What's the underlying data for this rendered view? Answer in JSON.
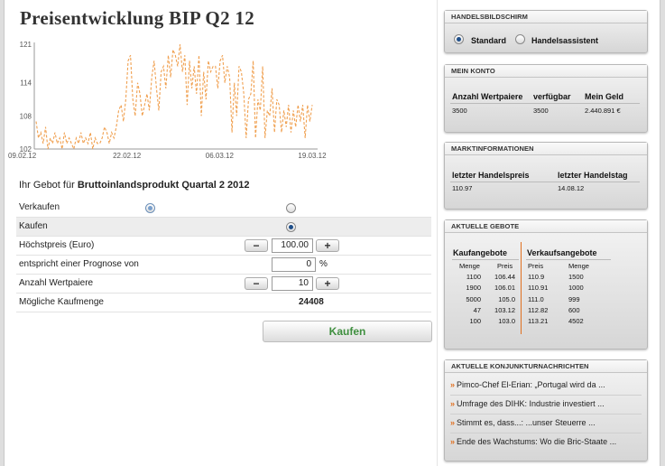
{
  "title": "Preisentwicklung BIP Q2 12",
  "chart_data": {
    "type": "line",
    "y_ticks": [
      "121",
      "114",
      "108",
      "102"
    ],
    "x_ticks": [
      "09.02.12",
      "22.02.12",
      "06.03.12",
      "19.03.12"
    ],
    "ylim": [
      102,
      121
    ],
    "line_color": "#f0a050",
    "line_style": "dashed",
    "series": [
      {
        "values": [
          107,
          104,
          105,
          103,
          106,
          102,
          104,
          103,
          105,
          103,
          104,
          102,
          105,
          103,
          104,
          103,
          102,
          104,
          103,
          105,
          103,
          104,
          103,
          105,
          102,
          104,
          103,
          103,
          104,
          106,
          105,
          103,
          105,
          104,
          106,
          109,
          110,
          107,
          111,
          118,
          119,
          111,
          108,
          114,
          112,
          108,
          110,
          112,
          109,
          115,
          118,
          113,
          109,
          116,
          117,
          113,
          119,
          115,
          120,
          119,
          117,
          121,
          116,
          119,
          110,
          118,
          113,
          117,
          112,
          119,
          108,
          116,
          111,
          118,
          116,
          117,
          117,
          113,
          118,
          119,
          114,
          117,
          115,
          105,
          114,
          108,
          117,
          116,
          112,
          104,
          111,
          112,
          118,
          104,
          111,
          109,
          117,
          104,
          109,
          108,
          113,
          105,
          111,
          110,
          105,
          109,
          106,
          110,
          105,
          109,
          106,
          110,
          107,
          110,
          104,
          110,
          107,
          110
        ]
      }
    ]
  },
  "offer": {
    "prefix": "Ihr Gebot für",
    "instrument": "Bruttoinlandsprodukt Quartal 2 2012"
  },
  "form": {
    "sell_label": "Verkaufen",
    "buy_label": "Kaufen",
    "max_price_label": "Höchstpreis (Euro)",
    "max_price_value": "100.00",
    "forecast_label": "entspricht einer Prognose von",
    "forecast_value": "0",
    "forecast_unit": "%",
    "quantity_label": "Anzahl Wertpaiere",
    "quantity_value": "10",
    "possible_label": "Mögliche Kaufmenge",
    "possible_value": "24408",
    "minus_symbol": "−",
    "plus_symbol": "+",
    "submit_label": "Kaufen"
  },
  "screen_box": {
    "head": "HANDELSBILDSCHIRM",
    "standard_label": "Standard",
    "assistant_label": "Handelsassistent"
  },
  "account_box": {
    "head": "MEIN KONTO",
    "col1": "Anzahl Wertpaiere",
    "col2": "verfügbar",
    "col3": "Mein Geld",
    "v1": "3500",
    "v2": "3500",
    "v3": "2.440.891 €"
  },
  "market_box": {
    "head": "MARKTINFORMATIONEN",
    "col1": "letzter Handelspreis",
    "col2": "letzter Handelstag",
    "v1": "110.97",
    "v2": "14.08.12"
  },
  "offers_box": {
    "head": "AKTUELLE GEBOTE",
    "buy_title": "Kaufangebote",
    "sell_title": "Verkaufsangebote",
    "buy_cols": [
      "Menge",
      "Preis"
    ],
    "sell_cols": [
      "Preis",
      "Menge"
    ],
    "buy_rows": [
      [
        "1100",
        "106.44"
      ],
      [
        "1900",
        "106.01"
      ],
      [
        "5000",
        "105.0"
      ],
      [
        "47",
        "103.12"
      ],
      [
        "100",
        "103.0"
      ]
    ],
    "sell_rows": [
      [
        "110.9",
        "1500"
      ],
      [
        "110.91",
        "1000"
      ],
      [
        "111.0",
        "999"
      ],
      [
        "112.82",
        "600"
      ],
      [
        "113.21",
        "4502"
      ]
    ]
  },
  "news_box": {
    "head": "AKTUELLE KONJUNKTURNACHRICHTEN",
    "arrow": "»",
    "items": [
      "Pimco-Chef El-Erian: „Portugal wird da ...",
      "Umfrage des DIHK: Industrie investiert ...",
      "Stimmt es, dass...: ...unser Steuerre ...",
      "Ende des Wachstums: Wo die Bric-Staate ..."
    ]
  }
}
